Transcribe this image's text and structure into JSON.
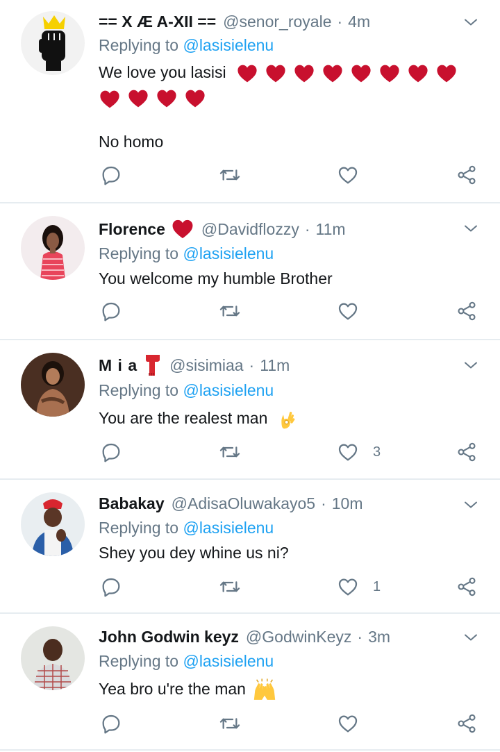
{
  "replying_label": "Replying to",
  "colors": {
    "link": "#1da1f2",
    "muted": "#657786",
    "heart_emoji": "#c8102e",
    "divider": "#e6ecf0"
  },
  "tweets": [
    {
      "name": "== X Æ A-XII ==",
      "handle": "@senor_royale",
      "dot": "·",
      "time": "4m",
      "reply_to": "@lasisielenu",
      "text_lines": [
        "We love you lasisi"
      ],
      "emoji_note": "heart emojis",
      "text_after": "No homo",
      "reply_count": "",
      "retweet_count": "",
      "like_count": ""
    },
    {
      "name": "Florence",
      "handle": "@Davidflozzy",
      "dot": "·",
      "time": "11m",
      "reply_to": "@lasisielenu",
      "text": "You welcome my humble Brother",
      "like_count": ""
    },
    {
      "name": "M i a",
      "handle": "@sisimiaa",
      "dot": "·",
      "time": "11m",
      "reply_to": "@lasisielenu",
      "text": "You are the realest man",
      "like_count": "3"
    },
    {
      "name": "Babakay",
      "handle": "@AdisaOluwakayo5",
      "dot": "·",
      "time": "10m",
      "reply_to": "@lasisielenu",
      "text": "Shey you dey whine us ni?",
      "like_count": "1"
    },
    {
      "name": "John Godwin keyz",
      "handle": "@GodwinKeyz",
      "dot": "·",
      "time": "3m",
      "reply_to": "@lasisielenu",
      "text": "Yea bro u're the man",
      "like_count": ""
    }
  ]
}
